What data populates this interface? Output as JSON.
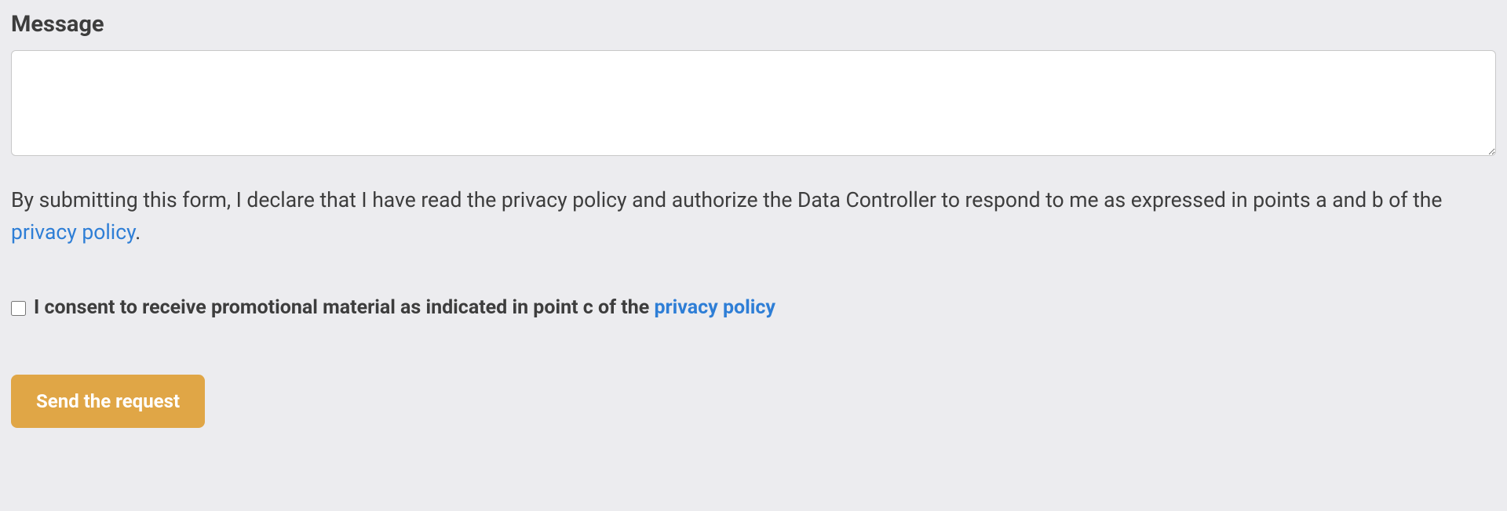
{
  "form": {
    "message_label": "Message",
    "message_value": "",
    "privacy_statement_prefix": "By submitting this form, I declare that I have read the privacy policy and authorize the Data Controller to respond to me as expressed in points a and b of the ",
    "privacy_statement_link": "privacy policy",
    "privacy_statement_suffix": ".",
    "consent_checkbox_checked": false,
    "consent_label_prefix": "I consent to receive promotional material as indicated in point c of the ",
    "consent_label_link": "privacy policy",
    "submit_button_label": "Send the request"
  },
  "colors": {
    "background": "#ececef",
    "text": "#3d3d3d",
    "link": "#2e7ed6",
    "button_bg": "#e0a646",
    "button_text": "#ffffff"
  }
}
